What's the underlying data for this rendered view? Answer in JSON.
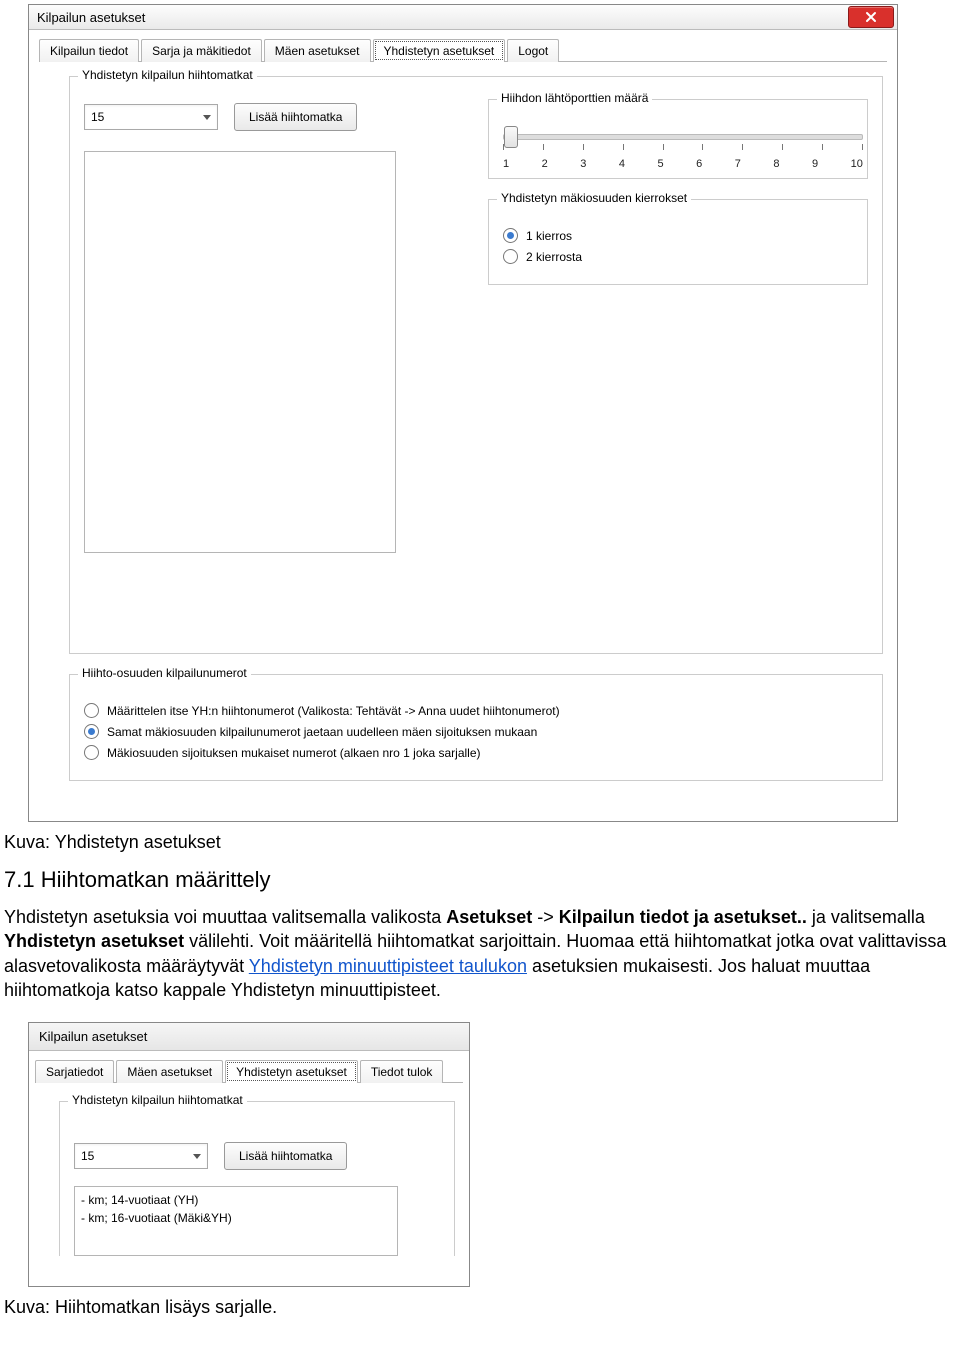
{
  "window1": {
    "title": "Kilpailun asetukset",
    "tabs": [
      "Kilpailun tiedot",
      "Sarja ja mäkitiedot",
      "Mäen asetukset",
      "Yhdistetyn asetukset",
      "Logot"
    ],
    "selectedTab": 3,
    "group_main_title": "Yhdistetyn kilpailun hiihtomatkat",
    "combo_value": "15",
    "add_btn": "Lisää hiihtomatka",
    "gates_title": "Hiihdon lähtöporttien määrä",
    "gates_ticks": [
      "1",
      "2",
      "3",
      "4",
      "5",
      "6",
      "7",
      "8",
      "9",
      "10"
    ],
    "rounds_title": "Yhdistetyn mäkiosuuden kierrokset",
    "rounds_options": [
      "1 kierros",
      "2 kierrosta"
    ],
    "rounds_selected": 0,
    "nums_title": "Hiihto-osuuden kilpailunumerot",
    "nums_options": [
      "Määrittelen itse YH:n hiihtonumerot (Valikosta: Tehtävät -> Anna uudet hiihtonumerot)",
      "Samat mäkiosuuden kilpailunumerot jaetaan uudelleen mäen sijoituksen mukaan",
      "Mäkiosuuden sijoituksen mukaiset numerot (alkaen nro 1 joka sarjalle)"
    ],
    "nums_selected": 1
  },
  "caption1": "Kuva: Yhdistetyn asetukset",
  "heading": "7.1  Hiihtomatkan määrittely",
  "paragraph": {
    "p1": "Yhdistetyn asetuksia voi muuttaa valitsemalla valikosta ",
    "b1": "Asetukset",
    "p2": " -> ",
    "b2": "Kilpailun tiedot ja asetukset..",
    "p3": " ja valitsemalla ",
    "b3": "Yhdistetyn asetukset",
    "p4": " välilehti. Voit määritellä hiihtomatkat sarjoittain. Huomaa että hiihtomatkat jotka ovat valittavissa alasvetovalikosta määräytyvät ",
    "link": "Yhdistetyn minuuttipisteet taulukon",
    "p5": " asetuksien mukaisesti. Jos haluat muuttaa hiihtomatkoja katso kappale Yhdistetyn minuuttipisteet."
  },
  "window2": {
    "title": "Kilpailun asetukset",
    "tabs": [
      "Sarjatiedot",
      "Mäen asetukset",
      "Yhdistetyn asetukset",
      "Tiedot tulok"
    ],
    "selectedTab": 2,
    "group_title": "Yhdistetyn kilpailun hiihtomatkat",
    "combo_value": "15",
    "add_btn": "Lisää hiihtomatka",
    "list": [
      "- km; 14-vuotiaat (YH)",
      "- km; 16-vuotiaat (Mäki&YH)"
    ]
  },
  "caption2": "Kuva: Hiihtomatkan lisäys sarjalle."
}
